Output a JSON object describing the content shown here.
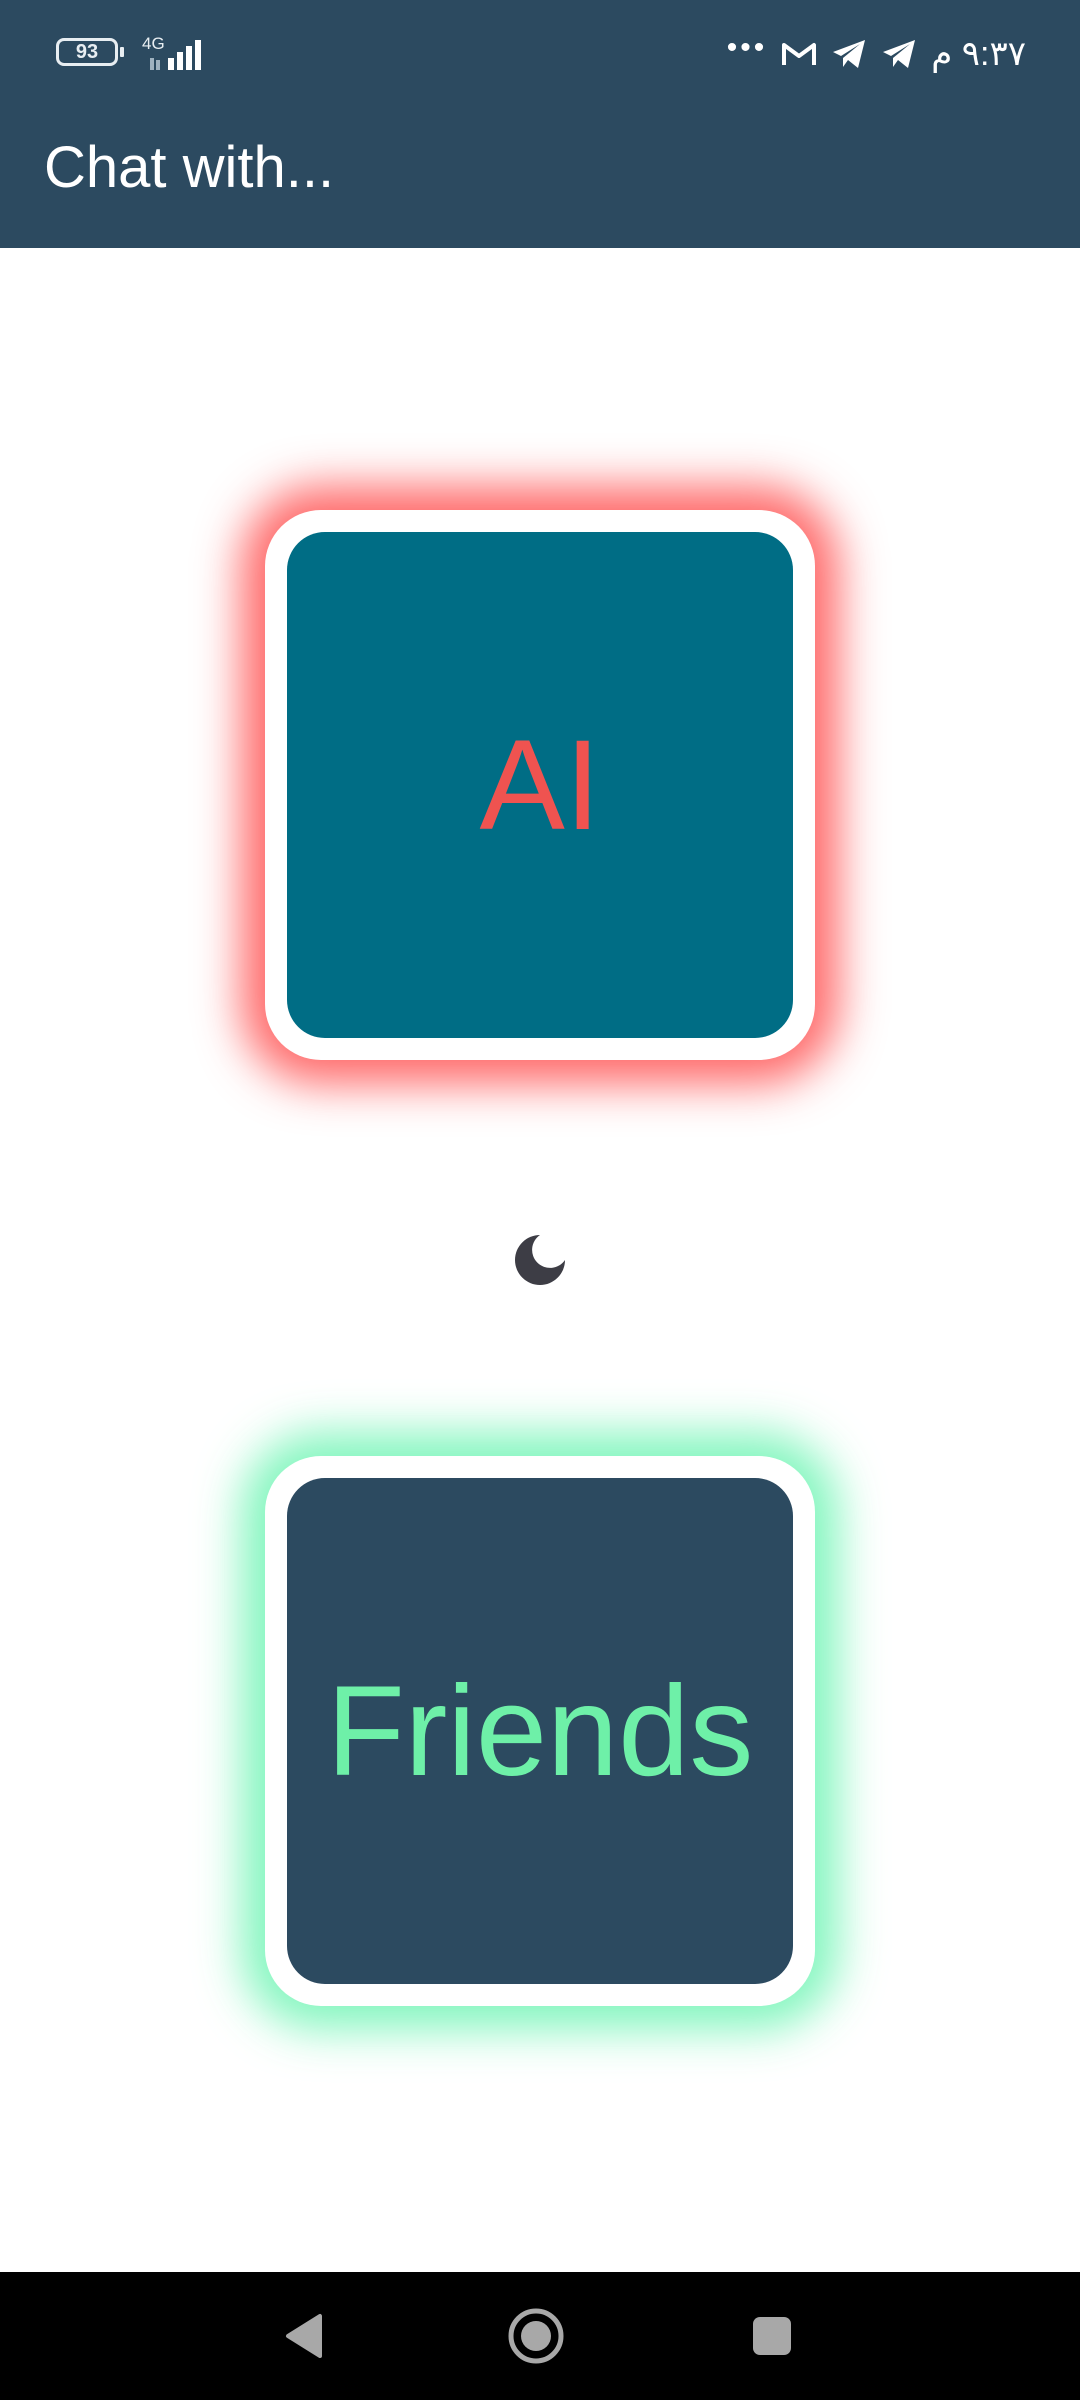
{
  "status_bar": {
    "battery": "93",
    "network_type": "4G",
    "overflow": "•••",
    "clock": "٩:٣٧ م",
    "icons": [
      "battery-icon",
      "signal-icon",
      "gmail-icon",
      "telegram-icon",
      "telegram-icon"
    ]
  },
  "app_bar": {
    "title": "Chat with..."
  },
  "main": {
    "ai_card_label": "AI",
    "friends_card_label": "Friends",
    "theme_toggle_icon": "moon-icon"
  },
  "nav_bar": {
    "icons": [
      "back-icon",
      "home-icon",
      "recents-icon"
    ]
  },
  "colors": {
    "primary": "#2c4a60",
    "ai_card": "#006d85",
    "ai_text": "#ef5350",
    "ai_glow": "#ff5050",
    "friends_text": "#6ef0a8",
    "friends_glow": "#6ef5b4"
  }
}
